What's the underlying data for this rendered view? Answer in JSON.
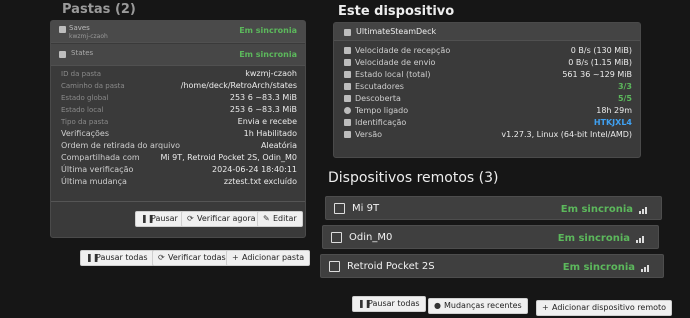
{
  "folders": {
    "section_title": "Pastas (2)",
    "items": [
      {
        "name": "Saves",
        "id": "kwzmj-czaoh",
        "status": "Em sincronia"
      },
      {
        "name": "States",
        "status": "Em sincronia"
      }
    ],
    "details": [
      {
        "label": "ID da pasta",
        "value": "kwzmj-czaoh"
      },
      {
        "label": "Caminho da pasta",
        "value": "/home/deck/RetroArch/states"
      },
      {
        "label": "Estado global",
        "value": "253  6  ~83.3 MiB"
      },
      {
        "label": "Estado local",
        "value": "253  6  ~83.3 MiB"
      },
      {
        "label": "Tipo da pasta",
        "value": "Envia e recebe"
      },
      {
        "label": "Verificações",
        "value": "1h   Habilitado"
      },
      {
        "label": "Ordem de retirada do arquivo",
        "value": "Aleatória"
      },
      {
        "label": "Compartilhada com",
        "value": "Mi 9T, Retroid Pocket 2S, Odin_M0"
      },
      {
        "label": "Última verificação",
        "value": "2024-06-24 18:40:11"
      },
      {
        "label": "Última mudança",
        "value": "zztest.txt excluído"
      }
    ],
    "actions": {
      "pause": "Pausar",
      "rescan": "Verificar agora",
      "edit": "Editar"
    },
    "global_actions": {
      "pause_all": "Pausar todas",
      "rescan_all": "Verificar todas",
      "add": "Adicionar pasta"
    }
  },
  "this_device": {
    "section_title": "Este dispositivo",
    "name": "UltimateSteamDeck",
    "stats": [
      {
        "label": "Velocidade de recepção",
        "value": "0 B/s (130 MiB)"
      },
      {
        "label": "Velocidade de envio",
        "value": "0 B/s (1.15 MiB)"
      },
      {
        "label": "Estado local (total)",
        "value": "561  36  ~129 MiB"
      },
      {
        "label": "Escutadores",
        "value": "3/3"
      },
      {
        "label": "Descoberta",
        "value": "5/5"
      },
      {
        "label": "Tempo ligado",
        "value": "18h 29m"
      },
      {
        "label": "Identificação",
        "value": "HTKJXL4"
      },
      {
        "label": "Versão",
        "value": "v1.27.3, Linux (64-bit Intel/AMD)"
      }
    ]
  },
  "remote_devices": {
    "section_title": "Dispositivos remotos (3)",
    "items": [
      {
        "name": "Mi 9T",
        "status": "Em sincronia"
      },
      {
        "name": "Odin_M0",
        "status": "Em sincronia"
      },
      {
        "name": "Retroid Pocket 2S",
        "status": "Em sincronia"
      }
    ],
    "actions": {
      "pause_all": "Pausar todas",
      "recent_changes": "Mudanças recentes",
      "add": "Adicionar dispositivo remoto"
    }
  }
}
